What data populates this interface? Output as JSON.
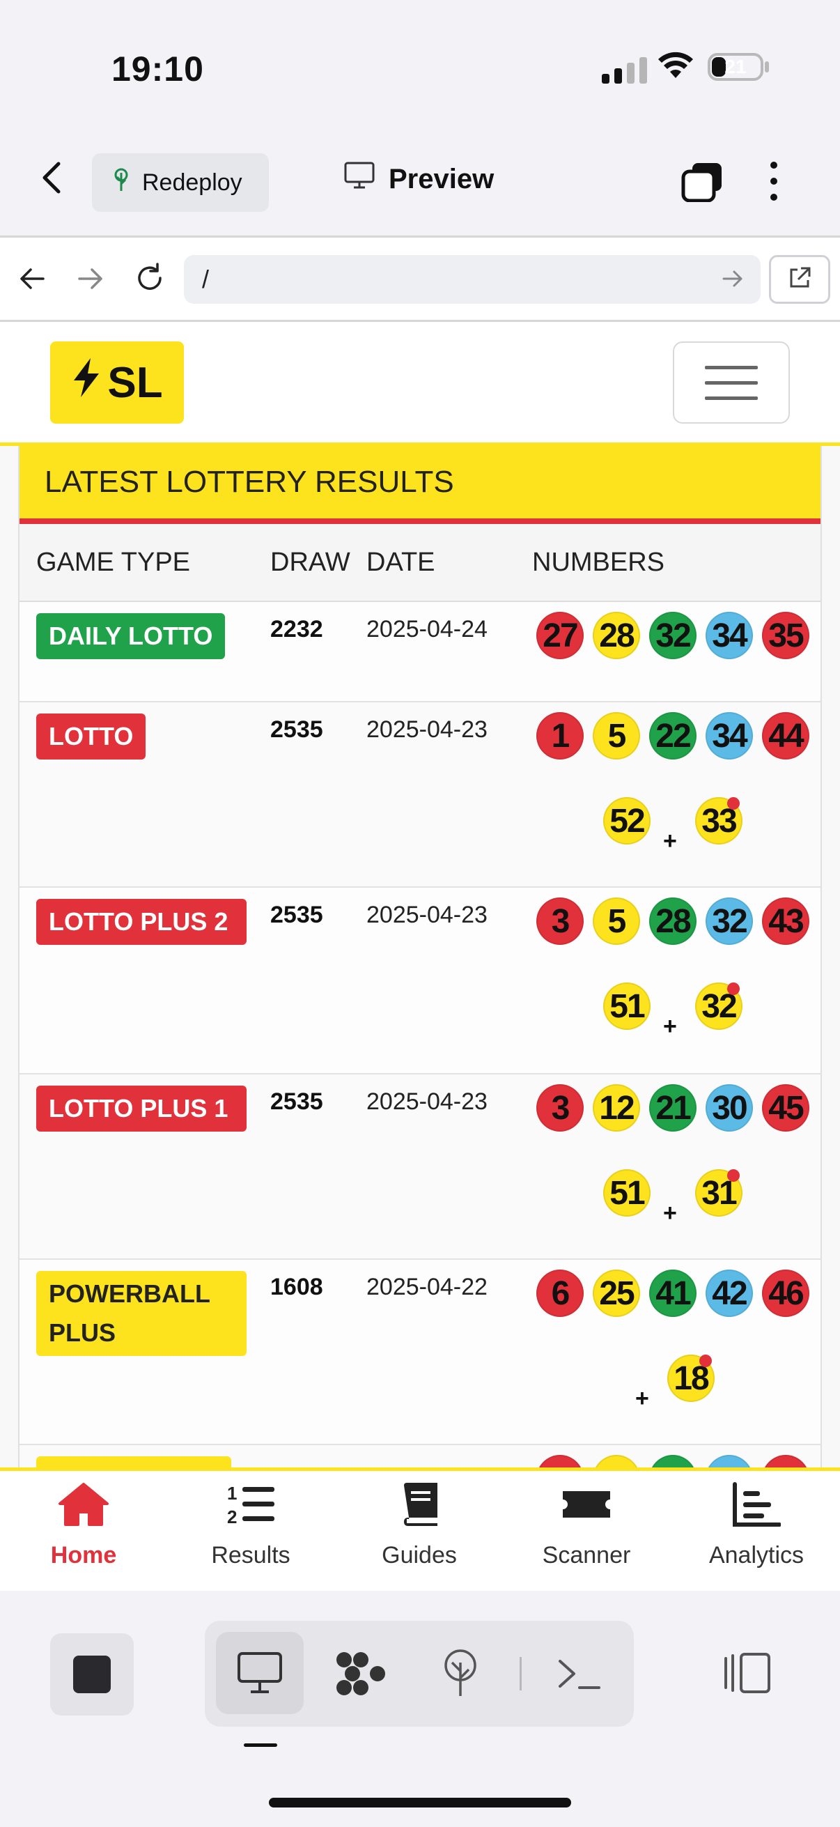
{
  "status_bar": {
    "time": "19:10",
    "battery": "21"
  },
  "top_bar": {
    "redeploy_label": "Redeploy",
    "preview_label": "Preview"
  },
  "browser": {
    "url": "/"
  },
  "site": {
    "logo_text": "SL"
  },
  "results": {
    "title": "LATEST LOTTERY RESULTS",
    "columns": {
      "game_type": "GAME TYPE",
      "draw": "DRAW",
      "date": "DATE",
      "numbers": "NUMBERS"
    },
    "rows": [
      {
        "game": "DAILY LOTTO",
        "draw": "2232",
        "date": "2025-04-24",
        "numbers": [
          "27",
          "28",
          "32",
          "34",
          "35"
        ],
        "extra": []
      },
      {
        "game": "LOTTO",
        "draw": "2535",
        "date": "2025-04-23",
        "numbers": [
          "1",
          "5",
          "22",
          "34",
          "44"
        ],
        "extra": [
          "52"
        ],
        "bonus": "33"
      },
      {
        "game": "LOTTO PLUS 2",
        "draw": "2535",
        "date": "2025-04-23",
        "numbers": [
          "3",
          "5",
          "28",
          "32",
          "43"
        ],
        "extra": [
          "51"
        ],
        "bonus": "32"
      },
      {
        "game": "LOTTO PLUS 1",
        "draw": "2535",
        "date": "2025-04-23",
        "numbers": [
          "3",
          "12",
          "21",
          "30",
          "45"
        ],
        "extra": [
          "51"
        ],
        "bonus": "31"
      },
      {
        "game": "POWERBALL PLUS",
        "draw": "1608",
        "date": "2025-04-22",
        "numbers": [
          "6",
          "25",
          "41",
          "42",
          "46"
        ],
        "extra": [],
        "bonus": "18"
      }
    ],
    "plus_sign": "+"
  },
  "bottom_nav": {
    "items": [
      {
        "label": "Home"
      },
      {
        "label": "Results"
      },
      {
        "label": "Guides"
      },
      {
        "label": "Scanner"
      },
      {
        "label": "Analytics"
      }
    ]
  },
  "colors": {
    "brand_yellow": "#fde21e",
    "brand_red": "#e1313a",
    "ball_green": "#1fa24a",
    "ball_blue": "#5bbbe6"
  }
}
